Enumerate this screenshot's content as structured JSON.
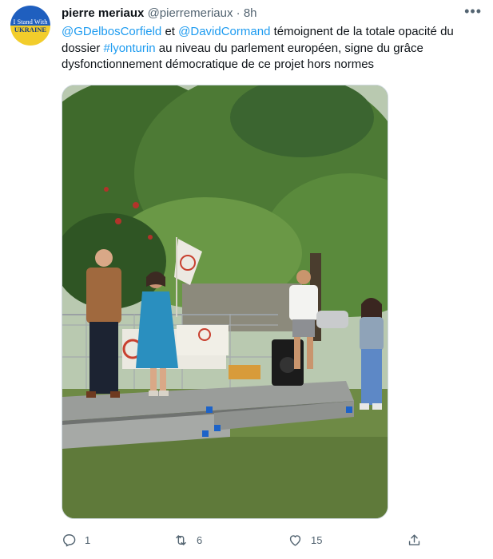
{
  "avatar": {
    "line1": "I Stand With",
    "line2": "UKRAINE"
  },
  "header": {
    "name": "pierre meriaux",
    "handle": "@pierremeriaux",
    "separator": "·",
    "time": "8h",
    "more": "•••"
  },
  "tweet": {
    "mention1": "@GDelbosCorfield",
    "t1": " et ",
    "mention2": "@DavidCormand",
    "t2": " témoignent de la totale opacité du dossier ",
    "hashtag": "#lyonturin",
    "t3": " au niveau du parlement européen, signe du grâce dysfonctionnement démocratique de ce projet hors normes"
  },
  "actions": {
    "replies": "1",
    "retweets": "6",
    "likes": "15"
  },
  "colors": {
    "link": "#1d9bf0",
    "text": "#0f1419",
    "muted": "#536471"
  },
  "icons": [
    "reply-icon",
    "retweet-icon",
    "like-icon",
    "share-icon",
    "more-icon"
  ]
}
